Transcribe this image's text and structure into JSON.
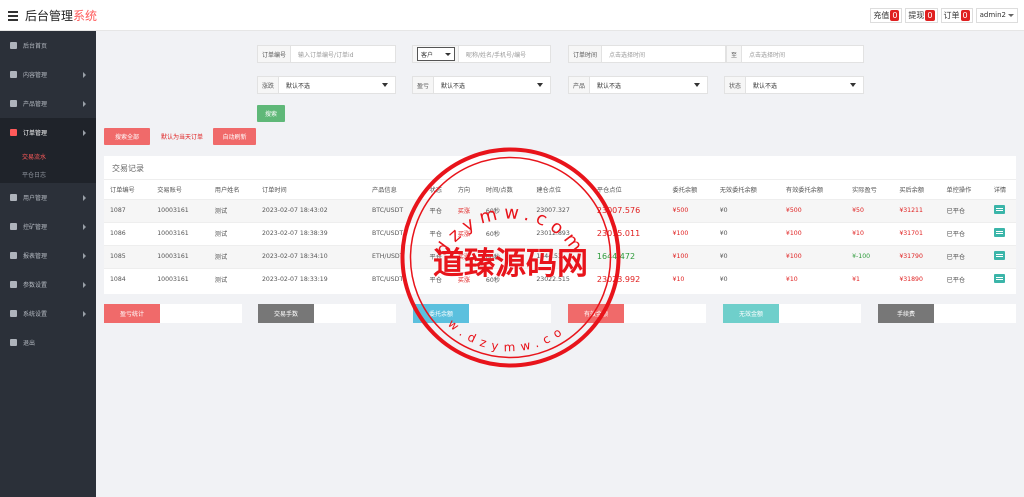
{
  "header": {
    "title_main": "后台管理",
    "title_accent": "系统",
    "chips": [
      {
        "label": "充值",
        "count": "0"
      },
      {
        "label": "提现",
        "count": "0"
      },
      {
        "label": "订单",
        "count": "0"
      }
    ],
    "user": "admin2"
  },
  "sidebar": {
    "items": [
      {
        "label": "后台首页",
        "icon": "dashboard-icon"
      },
      {
        "label": "内容管理",
        "icon": "content-icon"
      },
      {
        "label": "产品管理",
        "icon": "bitcoin-icon"
      },
      {
        "label": "订单管理",
        "icon": "order-icon"
      },
      {
        "label": "交易流水",
        "icon": ""
      },
      {
        "label": "平仓日志",
        "icon": ""
      },
      {
        "label": "用户管理",
        "icon": "user-icon"
      },
      {
        "label": "控矿管理",
        "icon": "control-icon"
      },
      {
        "label": "报表管理",
        "icon": "report-icon"
      },
      {
        "label": "参数设置",
        "icon": "settings-icon"
      },
      {
        "label": "系统设置",
        "icon": "gear-icon"
      },
      {
        "label": "退出",
        "icon": "logout-icon"
      }
    ]
  },
  "filters": {
    "order_no_label": "订单编号",
    "order_no_placeholder": "输入订单编号/订单id",
    "customer_type": "客户",
    "customer_placeholder": "昵称/姓名/手机号/编号",
    "order_time_label": "订单时间",
    "order_time_start_placeholder": "点击选择时间",
    "to_label": "至",
    "order_time_end_placeholder": "点击选择时间",
    "direction_label": "涨跌",
    "direction_value": "默认不选",
    "pnl_label": "盈亏",
    "pnl_value": "默认不选",
    "product_label": "产品",
    "product_value": "默认不选",
    "status_label": "状态",
    "status_value": "默认不选",
    "search_button": "搜索",
    "search_all_button": "搜索全部",
    "default_note": "默认为当天订单",
    "auto_refresh_button": "自动刷新"
  },
  "table": {
    "title": "交易记录",
    "columns": [
      "订单编号",
      "交易账号",
      "用户姓名",
      "订单时间",
      "产品信息",
      "状态",
      "方向",
      "时间/点数",
      "建仓点位",
      "平仓点位",
      "委托余额",
      "无效委托余额",
      "有效委托余额",
      "实际盈亏",
      "买后余额",
      "单控操作",
      "详情"
    ],
    "rows": [
      [
        "1087",
        "10003161",
        "测试",
        "2023-02-07 18:43:02",
        "BTC/USDT",
        "平仓",
        "买涨",
        "60秒",
        "23007.327",
        "23007.576",
        "¥500",
        "¥0",
        "¥500",
        "¥50",
        "¥31211",
        "已平仓"
      ],
      [
        "1086",
        "10003161",
        "测试",
        "2023-02-07 18:38:39",
        "BTC/USDT",
        "平仓",
        "买涨",
        "60秒",
        "23012.893",
        "23015.011",
        "¥100",
        "¥0",
        "¥100",
        "¥10",
        "¥31701",
        "已平仓"
      ],
      [
        "1085",
        "10003161",
        "测试",
        "2023-02-07 18:34:10",
        "ETH/USDT",
        "平仓",
        "买涨",
        "60秒",
        "1644.53",
        "1644.472",
        "¥100",
        "¥0",
        "¥100",
        "¥-100",
        "¥31790",
        "已平仓"
      ],
      [
        "1084",
        "10003161",
        "测试",
        "2023-02-07 18:33:19",
        "BTC/USDT",
        "平仓",
        "买涨",
        "60秒",
        "23022.515",
        "23023.992",
        "¥10",
        "¥0",
        "¥10",
        "¥1",
        "¥31890",
        "已平仓"
      ]
    ],
    "pnl_colors": [
      "red",
      "red",
      "green",
      "red"
    ]
  },
  "stats": [
    {
      "label": "盈亏统计",
      "color": "#f06a6a"
    },
    {
      "label": "交易手数",
      "color": "#777777"
    },
    {
      "label": "委托余额",
      "color": "#5bc0de"
    },
    {
      "label": "有效金额",
      "color": "#f06a6a"
    },
    {
      "label": "无效金额",
      "color": "#6fcfcb"
    },
    {
      "label": "手续费",
      "color": "#777777"
    }
  ],
  "watermark": {
    "center_text": "道臻源码网",
    "ring_text": "dzymw.com",
    "ring_text_bottom": "w.dzymw.co",
    "color": "#e8141b"
  }
}
